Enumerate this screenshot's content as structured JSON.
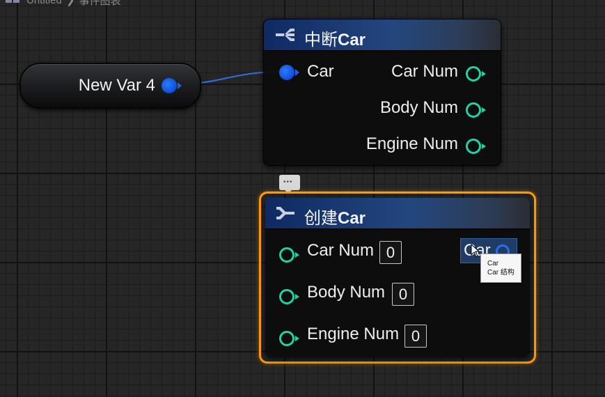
{
  "breadcrumb": {
    "project": "Untitled",
    "separator": "❯",
    "graph": "事件图表"
  },
  "var_node": {
    "label": "New Var 4"
  },
  "break_node": {
    "title_prefix": "中断",
    "title_bold": "Car",
    "input_label": "Car",
    "outputs": [
      "Car Num",
      "Body Num",
      "Engine Num"
    ]
  },
  "make_node": {
    "title_prefix": "创建",
    "title_bold": "Car",
    "inputs": [
      {
        "label": "Car Num",
        "value": "0"
      },
      {
        "label": "Body Num",
        "value": "0"
      },
      {
        "label": "Engine Num",
        "value": "0"
      }
    ],
    "output_label": "Car"
  },
  "tooltip": {
    "line1": "Car",
    "line2": "Car 结构"
  },
  "colors": {
    "struct_pin": "#1e5fe8",
    "int_pin": "#1fd4a4",
    "selection": "#ff9a00"
  }
}
